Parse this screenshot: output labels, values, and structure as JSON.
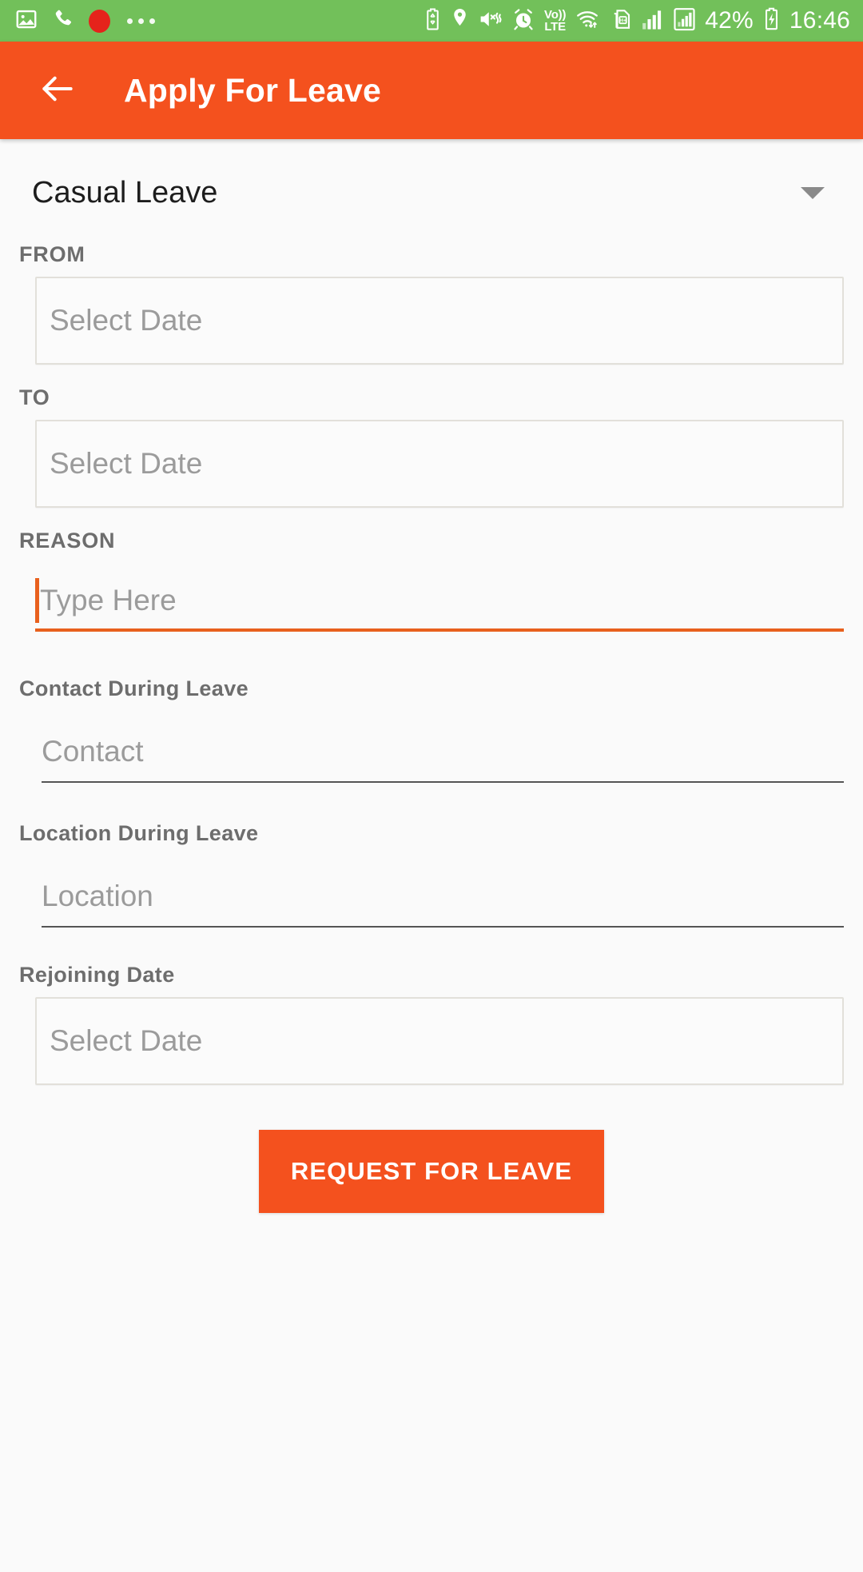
{
  "status_bar": {
    "background_color": "#72c05a",
    "left_icons": [
      {
        "name": "image-icon"
      },
      {
        "name": "phone-call-icon"
      },
      {
        "name": "recording-dot-icon"
      },
      {
        "name": "more-dots-icon"
      }
    ],
    "right_icons": [
      {
        "name": "battery-saver-icon"
      },
      {
        "name": "location-icon"
      },
      {
        "name": "volume-mute-vibrate-icon"
      },
      {
        "name": "alarm-clock-icon"
      },
      {
        "name": "volte-icon",
        "line1": "Vo))",
        "line2": "LTE"
      },
      {
        "name": "wifi-data-transfer-icon"
      },
      {
        "name": "sim-hplus-icon",
        "label": "H+"
      },
      {
        "name": "signal-bars-1-icon"
      },
      {
        "name": "signal-bars-2-icon"
      }
    ],
    "battery_percent": "42%",
    "clock": "16:46"
  },
  "app_bar": {
    "background_color": "#f4511e",
    "back_icon": "back-arrow-icon",
    "title": "Apply For Leave"
  },
  "form": {
    "leave_type": {
      "selected": "Casual Leave",
      "caret_icon": "chevron-down-icon"
    },
    "from": {
      "label": "FROM",
      "placeholder": "Select Date",
      "value": ""
    },
    "to": {
      "label": "TO",
      "placeholder": "Select Date",
      "value": ""
    },
    "reason": {
      "label": "REASON",
      "placeholder": "Type Here",
      "value": "",
      "focused": true,
      "accent_color": "#e8601d"
    },
    "contact": {
      "label": "Contact During Leave",
      "placeholder": "Contact",
      "value": ""
    },
    "location": {
      "label": "Location During Leave",
      "placeholder": "Location",
      "value": ""
    },
    "rejoining_date": {
      "label": "Rejoining Date",
      "placeholder": "Select Date",
      "value": ""
    },
    "submit": {
      "label": "REQUEST FOR LEAVE",
      "color": "#f4511e"
    }
  }
}
